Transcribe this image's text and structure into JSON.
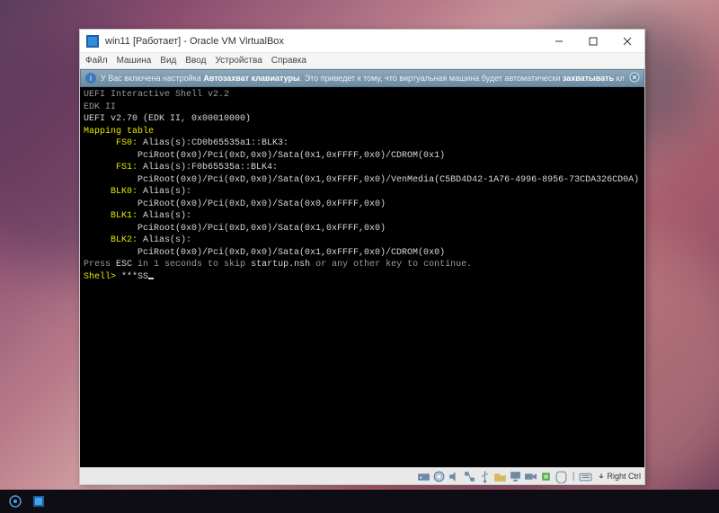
{
  "window": {
    "title": "win11 [Работает] - Oracle VM VirtualBox",
    "controls": {
      "minimize": "—",
      "maximize": "▢",
      "close": "✕"
    }
  },
  "menubar": [
    "Файл",
    "Машина",
    "Вид",
    "Ввод",
    "Устройства",
    "Справка"
  ],
  "infobar": {
    "text_before": "У Вас включена настройка ",
    "bold1": "Автозахват клавиатуры",
    "text_mid": ". Это приведет к тому, что виртуальная машина будет автоматически ",
    "bold2": "захватывать",
    "text_after": " клавиатуру каждый раз при переключении"
  },
  "console": {
    "header1": "UEFI Interactive Shell v2.2",
    "header2": "EDK II",
    "header3": "UEFI v2.70 (EDK II, 0x00010000)",
    "mapping_title": "Mapping table",
    "fs0_label": "      FS0:",
    "fs0_alias": " Alias(s):CD0b65535a1::BLK3:",
    "fs0_path": "          PciRoot(0x0)/Pci(0xD,0x0)/Sata(0x1,0xFFFF,0x0)/CDROM(0x1)",
    "fs1_label": "      FS1:",
    "fs1_alias": " Alias(s):F0b65535a::BLK4:",
    "fs1_path": "          PciRoot(0x0)/Pci(0xD,0x0)/Sata(0x1,0xFFFF,0x0)/VenMedia(C5BD4D42-1A76-4996-8956-73CDA326CD0A)",
    "blk0_label": "     BLK0:",
    "blk0_alias": " Alias(s):",
    "blk0_path": "          PciRoot(0x0)/Pci(0xD,0x0)/Sata(0x0,0xFFFF,0x0)",
    "blk1_label": "     BLK1:",
    "blk1_alias": " Alias(s):",
    "blk1_path": "          PciRoot(0x0)/Pci(0xD,0x0)/Sata(0x1,0xFFFF,0x0)",
    "blk2_label": "     BLK2:",
    "blk2_alias": " Alias(s):",
    "blk2_path": "          PciRoot(0x0)/Pci(0xD,0x0)/Sata(0x1,0xFFFF,0x0)/CDROM(0x0)",
    "press_pre": "Press ",
    "press_esc": "ESC",
    "press_mid": " in 1 seconds to skip ",
    "press_nsh": "startup.nsh",
    "press_post": " or any other key to continue.",
    "prompt_label": "Shell> ",
    "prompt_input": "***SS"
  },
  "statusbar": {
    "host_key": "Right Ctrl"
  },
  "icons": {
    "vbox": "vbox-icon",
    "info": "info-icon",
    "hdd": "hdd-icon",
    "cd": "cd-icon",
    "audio": "audio-icon",
    "net": "network-icon",
    "usb": "usb-icon",
    "shared": "shared-folder-icon",
    "display": "display-icon",
    "rec": "record-icon",
    "cpu": "cpu-icon",
    "mouse": "mouse-icon",
    "kbd": "keyboard-icon",
    "arrow": "host-key-arrow-icon"
  }
}
